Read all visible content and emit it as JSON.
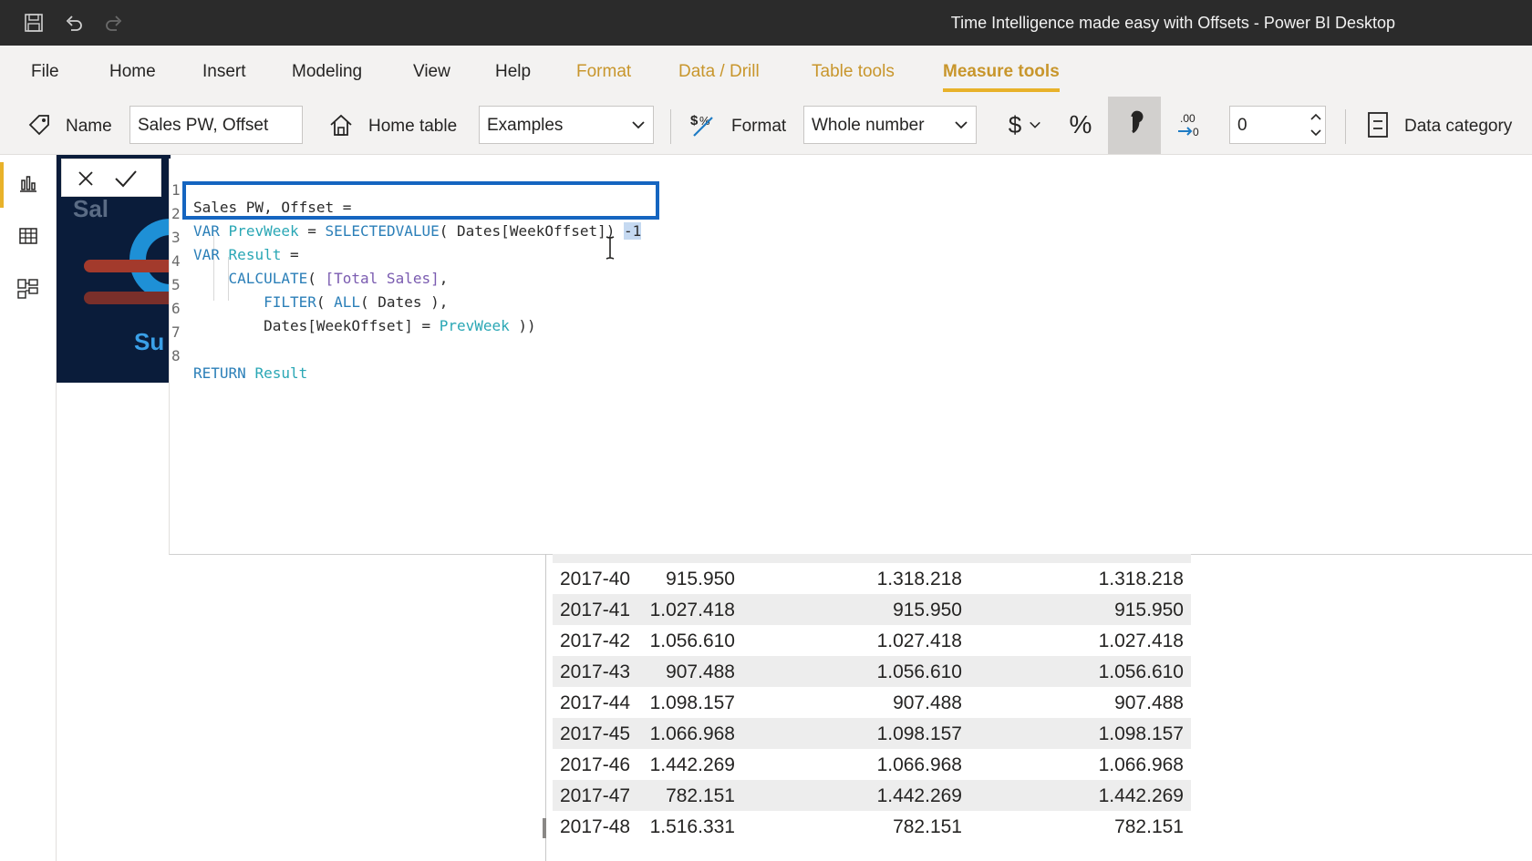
{
  "window": {
    "title": "Time Intelligence made easy with Offsets - Power BI Desktop",
    "quick_access": [
      "save-icon",
      "undo-icon",
      "redo-icon"
    ]
  },
  "menu": {
    "tabs": [
      {
        "label": "File"
      },
      {
        "label": "Home"
      },
      {
        "label": "Insert"
      },
      {
        "label": "Modeling"
      },
      {
        "label": "View"
      },
      {
        "label": "Help"
      },
      {
        "label": "Format"
      },
      {
        "label": "Data / Drill"
      },
      {
        "label": "Table tools"
      },
      {
        "label": "Measure tools"
      }
    ],
    "active": "Measure tools"
  },
  "ribbon": {
    "name_label": "Name",
    "name_value": "Sales PW, Offset",
    "home_table_label": "Home table",
    "home_table_value": "Examples",
    "format_label": "Format",
    "format_value": "Whole number",
    "currency_symbol": "$",
    "percent_symbol": "%",
    "decimal_places": "0",
    "data_category_label": "Data category"
  },
  "formula": {
    "lines": [
      {
        "n": "1",
        "text": "Sales PW, Offset ="
      },
      {
        "n": "2",
        "text": "VAR PrevWeek = SELECTEDVALUE( Dates[WeekOffset]) -1"
      },
      {
        "n": "3",
        "text": "VAR Result ="
      },
      {
        "n": "4",
        "text": "CALCULATE( [Total Sales],"
      },
      {
        "n": "5",
        "text": "FILTER( ALL( Dates ),"
      },
      {
        "n": "6",
        "text": "Dates[WeekOffset] = PrevWeek ))"
      },
      {
        "n": "7",
        "text": ""
      },
      {
        "n": "8",
        "text": "RETURN Result"
      }
    ]
  },
  "table": {
    "rows": [
      [
        "2017-40",
        "915.950",
        "1.318.218",
        "1.318.218"
      ],
      [
        "2017-41",
        "1.027.418",
        "915.950",
        "915.950"
      ],
      [
        "2017-42",
        "1.056.610",
        "1.027.418",
        "1.027.418"
      ],
      [
        "2017-43",
        "907.488",
        "1.056.610",
        "1.056.610"
      ],
      [
        "2017-44",
        "1.098.157",
        "907.488",
        "907.488"
      ],
      [
        "2017-45",
        "1.066.968",
        "1.098.157",
        "1.098.157"
      ],
      [
        "2017-46",
        "1.442.269",
        "1.066.968",
        "1.066.968"
      ],
      [
        "2017-47",
        "782.151",
        "1.442.269",
        "1.442.269"
      ],
      [
        "2017-48",
        "1.516.331",
        "782.151",
        "782.151"
      ]
    ]
  },
  "colors": {
    "accent": "#e8b22a",
    "highlight_box": "#1565c0",
    "titlebar": "#2b2b2b"
  }
}
